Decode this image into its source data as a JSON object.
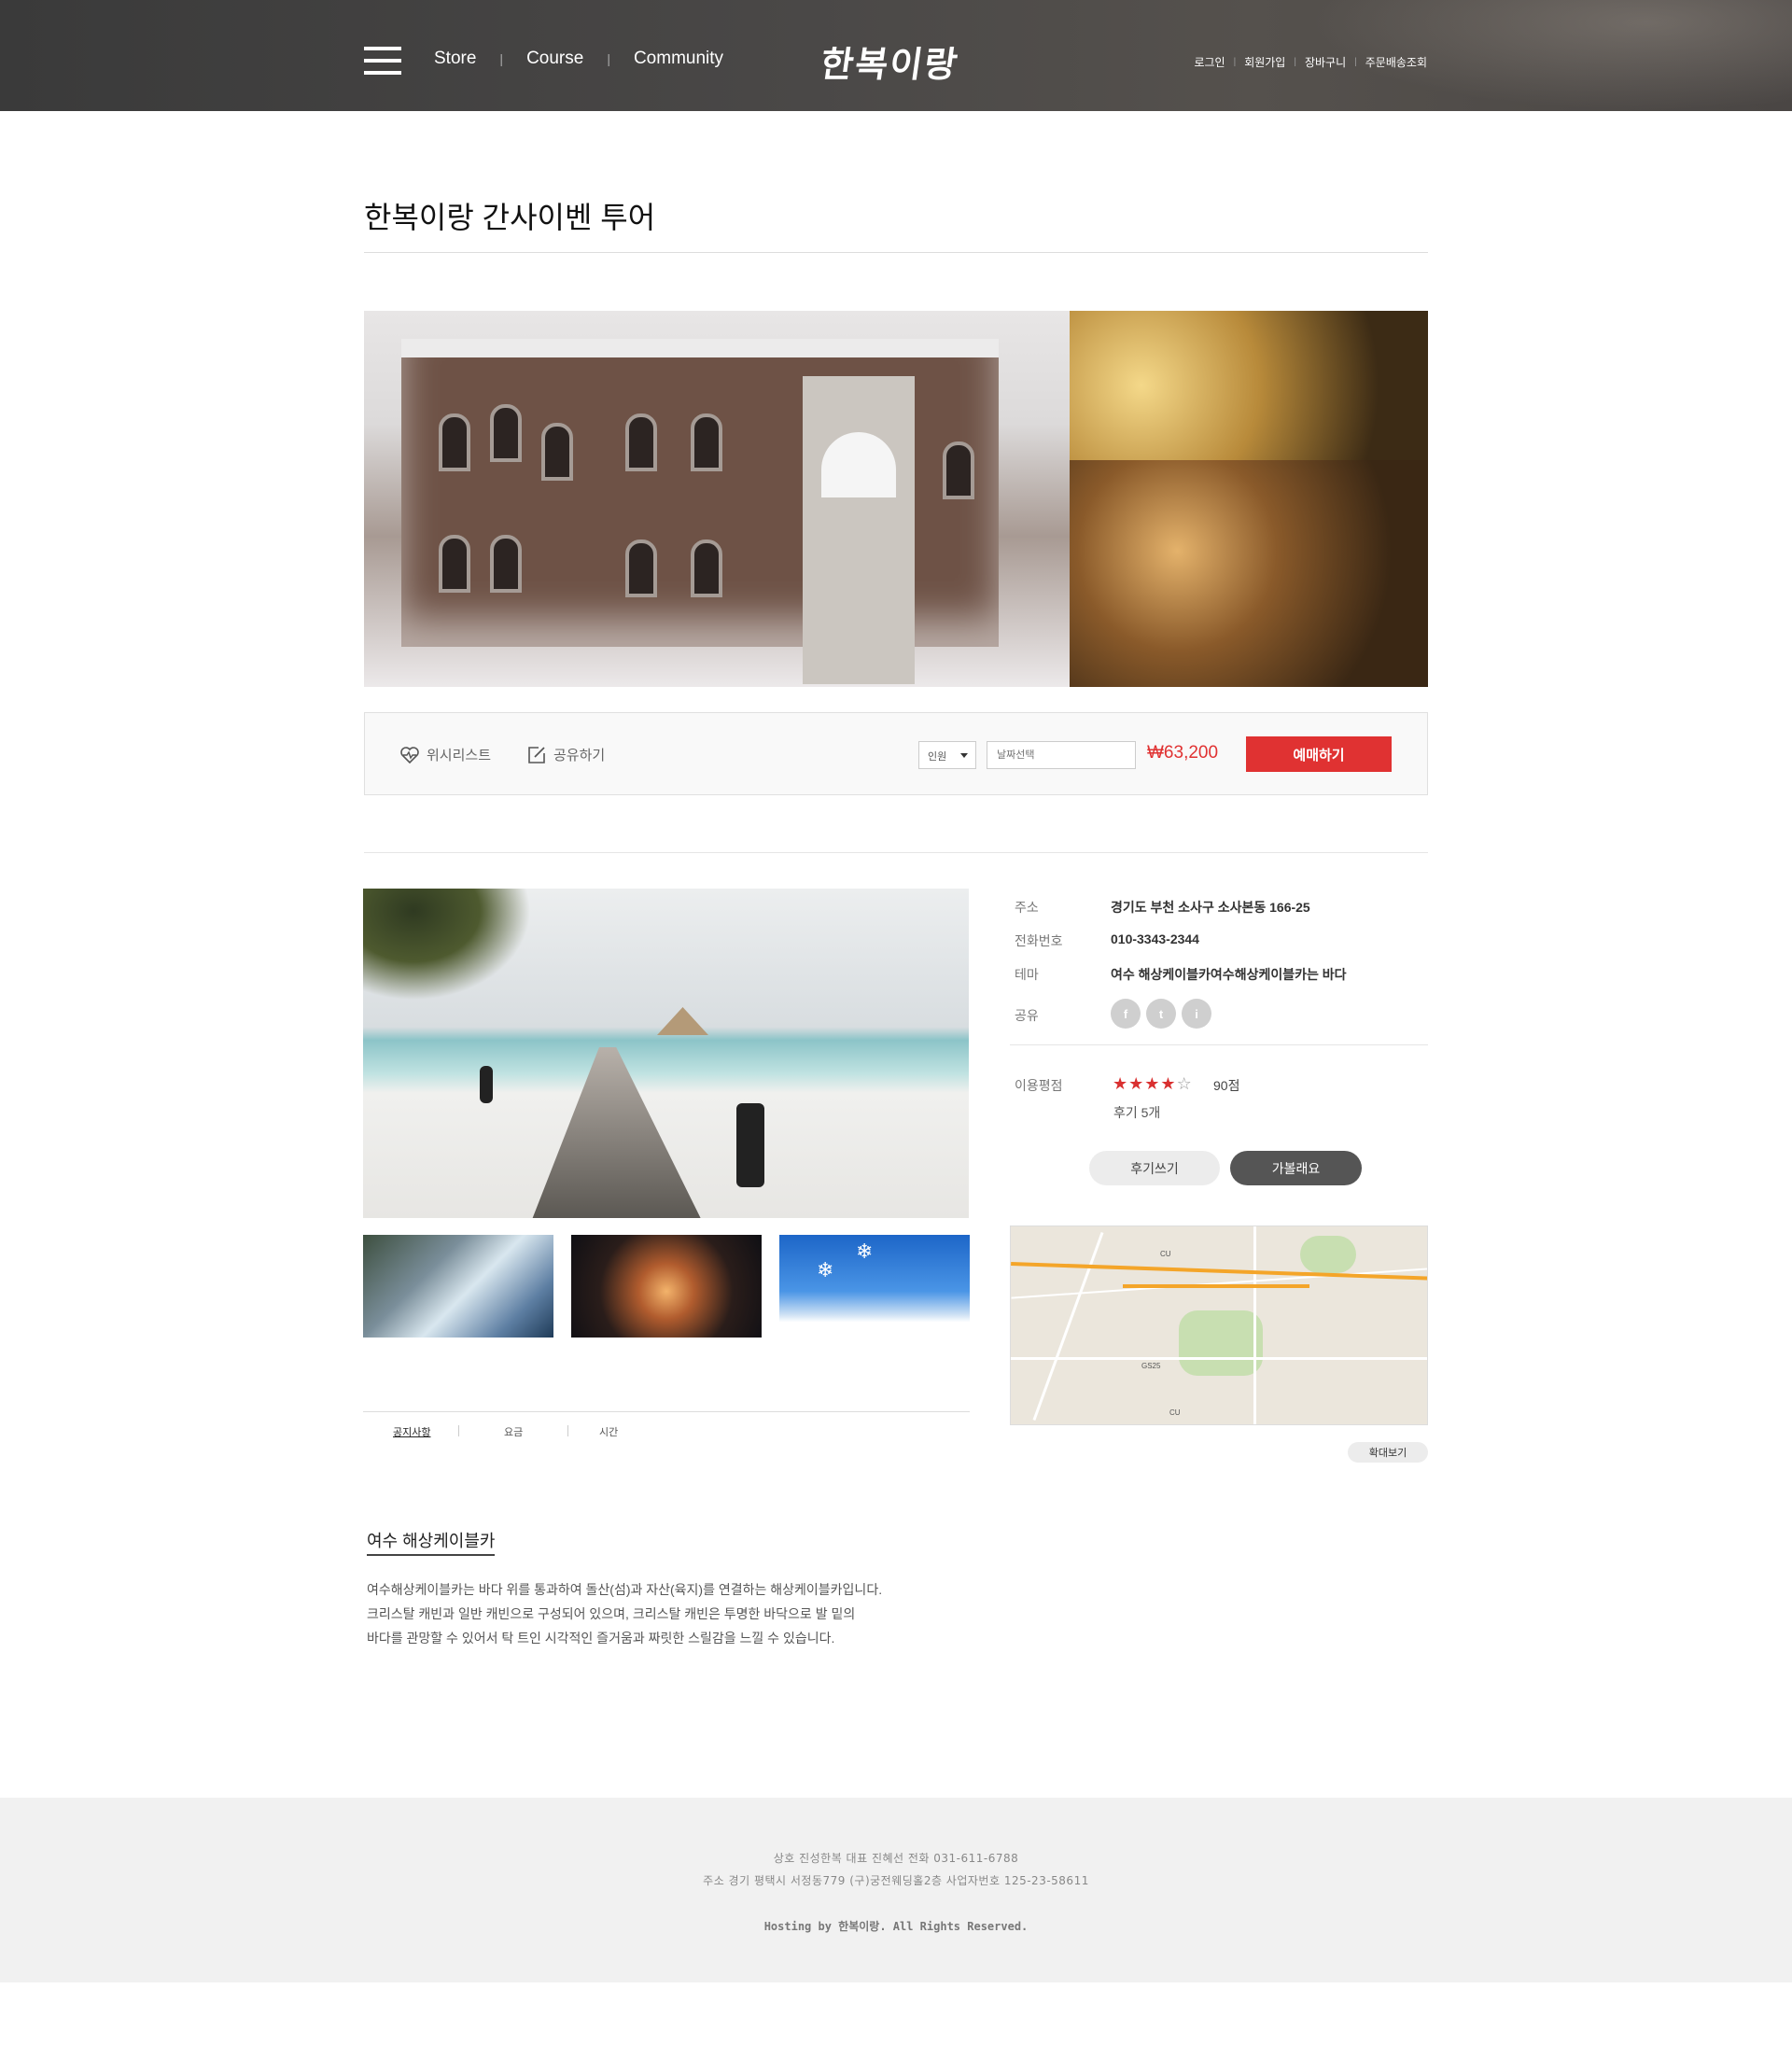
{
  "header": {
    "nav": [
      "Store",
      "Course",
      "Community"
    ],
    "logo_text": "한복이랑",
    "util_links": [
      "로그인",
      "회원가입",
      "장바구니",
      "주문배송조회"
    ]
  },
  "page_title": "한복이랑 간사이벤 투어",
  "action_bar": {
    "wishlist_label": "위시리스트",
    "share_label": "공유하기",
    "people_select": "인원",
    "date_placeholder": "날짜선택",
    "price": "₩63,200",
    "book_label": "예매하기"
  },
  "tabs": [
    "공지사항",
    "요금",
    "시간"
  ],
  "info": {
    "address_label": "주소",
    "address_value": "경기도 부천 소사구 소사본동 166-25",
    "phone_label": "전화번호",
    "phone_value": "010-3343-2344",
    "theme_label": "테마",
    "theme_value": "여수 해상케이블카여수해상케이블카는 바다",
    "share_label": "공유",
    "sns": [
      "f",
      "t",
      "i"
    ],
    "rating_label": "이용평점",
    "rating_stars": 4,
    "rating_max": 5,
    "score": "90점",
    "reviews": "후기 5개",
    "write_review_label": "후기쓰기",
    "want_to_go_label": "가볼래요"
  },
  "map": {
    "zoom_label": "확대보기"
  },
  "description": {
    "title": "여수 해상케이블카",
    "lines": [
      "여수해상케이블카는 바다 위를 통과하여 돌산(섬)과 자산(육지)를 연결하는 해상케이블카입니다.",
      "크리스탈 캐빈과 일반 캐빈으로 구성되어 있으며, 크리스탈 캐빈은 투명한 바닥으로 발 밑의",
      "바다를 관망할 수 있어서 탁 트인 시각적인 즐거움과 짜릿한 스릴감을 느낄 수 있습니다."
    ]
  },
  "footer": {
    "line1": "상호 진성한복 대표 진혜선 전화 031-611-6788",
    "line2": "주소 경기 평택시 서정동779 (구)궁전웨딩홀2층 사업자번호 125-23-58611",
    "copyright": "Hosting by 한복이랑. All Rights Reserved."
  },
  "colors": {
    "accent": "#e03232",
    "header_bg": "#444444",
    "footer_bg": "#f1f1f1"
  }
}
